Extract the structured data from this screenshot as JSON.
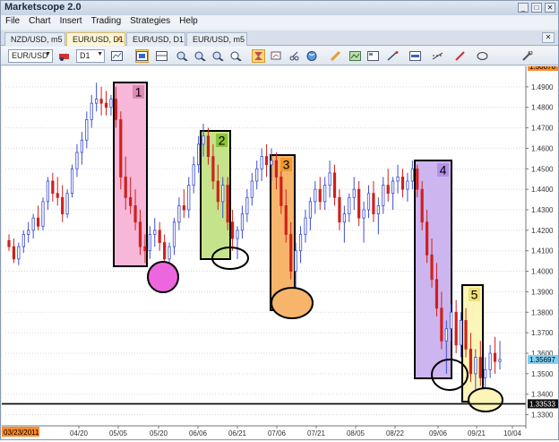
{
  "app": {
    "title": "Marketscope 2.0"
  },
  "window_buttons": [
    "_",
    "□",
    "✕"
  ],
  "menu": [
    "File",
    "Chart",
    "Insert",
    "Trading",
    "Strategies",
    "Help"
  ],
  "tabs": [
    {
      "label": "NZD/USD, m5",
      "active": false
    },
    {
      "label": "EUR/USD, D1",
      "active": true,
      "close": "✕"
    },
    {
      "label": "EUR/USD, D1",
      "active": false
    },
    {
      "label": "EUR/USD, m5",
      "active": false
    }
  ],
  "tab_close": "✕",
  "toolbar": {
    "instrument": "EUR/USD",
    "timeframe": "D1",
    "icons": [
      "bar-style-icon",
      "period-icon",
      "indicator-icon",
      "chart-type-icon",
      "layout-icon",
      "zoom-in-icon",
      "zoom-out-icon",
      "zoom-fit-icon",
      "scroll-icon",
      "zoom-icon",
      "crosshair-icon",
      "properties-icon",
      "cut-icon",
      "globe-icon",
      "pencil-icon",
      "template-icon",
      "save-image-icon",
      "drawing-icon",
      "color-icon",
      "line-style-icon",
      "pen-icon",
      "ellipse-icon",
      "settings-icon"
    ]
  },
  "chart_data": {
    "type": "candlestick",
    "y_axis": {
      "ticks": [
        "1.4900",
        "1.4800",
        "1.4700",
        "1.4600",
        "1.4500",
        "1.4400",
        "1.4300",
        "1.4200",
        "1.4100",
        "1.4000",
        "1.3900",
        "1.3800",
        "1.3700",
        "1.3600",
        "1.3500",
        "1.3400",
        "1.3300"
      ],
      "range": [
        1.325,
        1.5
      ]
    },
    "top_label": "1.50076",
    "current_price": "1.35697",
    "level_price": "1.33533",
    "level_value": 1.33533,
    "x_ticks": [
      "03/23/2011",
      "04/20",
      "05/05",
      "05/20",
      "06/06",
      "06/21",
      "07/06",
      "07/21",
      "08/05",
      "08/22",
      "09/06",
      "09/21",
      "10/04"
    ],
    "zones": [
      {
        "label": "1",
        "color": "#f7b7d9",
        "label_bg": "#e08ab5",
        "circle_color": "#ee66dd"
      },
      {
        "label": "2",
        "color": "#c5e38a",
        "label_bg": "#8fc23c",
        "circle_color": "#ffffff"
      },
      {
        "label": "3",
        "color": "#f7b56b",
        "label_bg": "#ee9a2e",
        "circle_color": "#f7b56b"
      },
      {
        "label": "4",
        "color": "#cdb5ef",
        "label_bg": "#b592e6",
        "circle_color": "#ffffff"
      },
      {
        "label": "5",
        "color": "#fbf5b8",
        "label_bg": "#f0e07a",
        "circle_color": "#fbf5b8"
      }
    ],
    "candles": [
      [
        1.415,
        1.418,
        1.41,
        1.412
      ],
      [
        1.412,
        1.416,
        1.404,
        1.406
      ],
      [
        1.406,
        1.414,
        1.403,
        1.412
      ],
      [
        1.412,
        1.42,
        1.409,
        1.418
      ],
      [
        1.418,
        1.424,
        1.414,
        1.42
      ],
      [
        1.42,
        1.428,
        1.416,
        1.426
      ],
      [
        1.426,
        1.432,
        1.42,
        1.422
      ],
      [
        1.422,
        1.436,
        1.42,
        1.434
      ],
      [
        1.434,
        1.446,
        1.43,
        1.444
      ],
      [
        1.444,
        1.448,
        1.434,
        1.438
      ],
      [
        1.438,
        1.446,
        1.432,
        1.436
      ],
      [
        1.436,
        1.442,
        1.424,
        1.428
      ],
      [
        1.428,
        1.44,
        1.426,
        1.438
      ],
      [
        1.438,
        1.452,
        1.436,
        1.45
      ],
      [
        1.45,
        1.462,
        1.446,
        1.458
      ],
      [
        1.458,
        1.468,
        1.452,
        1.464
      ],
      [
        1.464,
        1.478,
        1.46,
        1.474
      ],
      [
        1.474,
        1.486,
        1.47,
        1.482
      ],
      [
        1.482,
        1.492,
        1.478,
        1.484
      ],
      [
        1.484,
        1.49,
        1.476,
        1.482
      ],
      [
        1.482,
        1.488,
        1.476,
        1.48
      ],
      [
        1.48,
        1.486,
        1.476,
        1.484
      ],
      [
        1.484,
        1.49,
        1.47,
        1.474
      ],
      [
        1.474,
        1.478,
        1.44,
        1.446
      ],
      [
        1.446,
        1.456,
        1.43,
        1.436
      ],
      [
        1.436,
        1.446,
        1.428,
        1.432
      ],
      [
        1.432,
        1.44,
        1.42,
        1.424
      ],
      [
        1.424,
        1.43,
        1.408,
        1.412
      ],
      [
        1.412,
        1.418,
        1.404,
        1.41
      ],
      [
        1.41,
        1.422,
        1.406,
        1.418
      ],
      [
        1.418,
        1.426,
        1.412,
        1.42
      ],
      [
        1.42,
        1.424,
        1.41,
        1.414
      ],
      [
        1.414,
        1.418,
        1.402,
        1.406
      ],
      [
        1.406,
        1.414,
        1.398,
        1.412
      ],
      [
        1.412,
        1.426,
        1.408,
        1.424
      ],
      [
        1.424,
        1.436,
        1.42,
        1.432
      ],
      [
        1.432,
        1.44,
        1.426,
        1.43
      ],
      [
        1.43,
        1.446,
        1.426,
        1.442
      ],
      [
        1.442,
        1.456,
        1.438,
        1.452
      ],
      [
        1.452,
        1.466,
        1.448,
        1.462
      ],
      [
        1.462,
        1.472,
        1.456,
        1.466
      ],
      [
        1.466,
        1.47,
        1.452,
        1.456
      ],
      [
        1.456,
        1.462,
        1.44,
        1.444
      ],
      [
        1.444,
        1.452,
        1.43,
        1.434
      ],
      [
        1.434,
        1.446,
        1.426,
        1.442
      ],
      [
        1.442,
        1.446,
        1.42,
        1.424
      ],
      [
        1.424,
        1.43,
        1.41,
        1.416
      ],
      [
        1.416,
        1.422,
        1.406,
        1.42
      ],
      [
        1.42,
        1.432,
        1.416,
        1.428
      ],
      [
        1.428,
        1.44,
        1.424,
        1.436
      ],
      [
        1.436,
        1.448,
        1.432,
        1.444
      ],
      [
        1.444,
        1.454,
        1.44,
        1.45
      ],
      [
        1.45,
        1.46,
        1.444,
        1.456
      ],
      [
        1.456,
        1.462,
        1.446,
        1.452
      ],
      [
        1.452,
        1.46,
        1.444,
        1.454
      ],
      [
        1.454,
        1.458,
        1.44,
        1.446
      ],
      [
        1.446,
        1.452,
        1.428,
        1.432
      ],
      [
        1.432,
        1.44,
        1.414,
        1.418
      ],
      [
        1.418,
        1.424,
        1.396,
        1.4
      ],
      [
        1.4,
        1.414,
        1.388,
        1.41
      ],
      [
        1.41,
        1.422,
        1.404,
        1.418
      ],
      [
        1.418,
        1.43,
        1.414,
        1.426
      ],
      [
        1.426,
        1.436,
        1.42,
        1.434
      ],
      [
        1.434,
        1.444,
        1.428,
        1.44
      ],
      [
        1.44,
        1.446,
        1.43,
        1.434
      ],
      [
        1.434,
        1.446,
        1.43,
        1.442
      ],
      [
        1.442,
        1.454,
        1.436,
        1.448
      ],
      [
        1.448,
        1.452,
        1.432,
        1.436
      ],
      [
        1.436,
        1.44,
        1.42,
        1.424
      ],
      [
        1.424,
        1.432,
        1.414,
        1.428
      ],
      [
        1.428,
        1.438,
        1.424,
        1.436
      ],
      [
        1.436,
        1.446,
        1.43,
        1.44
      ],
      [
        1.44,
        1.444,
        1.422,
        1.426
      ],
      [
        1.426,
        1.434,
        1.414,
        1.43
      ],
      [
        1.43,
        1.442,
        1.426,
        1.438
      ],
      [
        1.438,
        1.444,
        1.424,
        1.428
      ],
      [
        1.428,
        1.436,
        1.418,
        1.432
      ],
      [
        1.432,
        1.446,
        1.428,
        1.442
      ],
      [
        1.442,
        1.45,
        1.434,
        1.438
      ],
      [
        1.438,
        1.446,
        1.43,
        1.444
      ],
      [
        1.444,
        1.452,
        1.438,
        1.446
      ],
      [
        1.446,
        1.45,
        1.436,
        1.44
      ],
      [
        1.44,
        1.448,
        1.434,
        1.444
      ],
      [
        1.444,
        1.454,
        1.44,
        1.45
      ],
      [
        1.45,
        1.452,
        1.436,
        1.44
      ],
      [
        1.44,
        1.444,
        1.42,
        1.424
      ],
      [
        1.424,
        1.43,
        1.404,
        1.408
      ],
      [
        1.408,
        1.416,
        1.392,
        1.396
      ],
      [
        1.396,
        1.404,
        1.378,
        1.382
      ],
      [
        1.382,
        1.39,
        1.362,
        1.366
      ],
      [
        1.366,
        1.376,
        1.35,
        1.372
      ],
      [
        1.372,
        1.384,
        1.366,
        1.38
      ],
      [
        1.38,
        1.386,
        1.36,
        1.364
      ],
      [
        1.364,
        1.38,
        1.358,
        1.376
      ],
      [
        1.376,
        1.382,
        1.358,
        1.362
      ],
      [
        1.362,
        1.37,
        1.346,
        1.35
      ],
      [
        1.35,
        1.362,
        1.34,
        1.358
      ],
      [
        1.358,
        1.366,
        1.344,
        1.348
      ],
      [
        1.348,
        1.358,
        1.34,
        1.352
      ],
      [
        1.352,
        1.364,
        1.348,
        1.36
      ],
      [
        1.36,
        1.368,
        1.35,
        1.356
      ],
      [
        1.356,
        1.366,
        1.352,
        1.357
      ]
    ]
  }
}
